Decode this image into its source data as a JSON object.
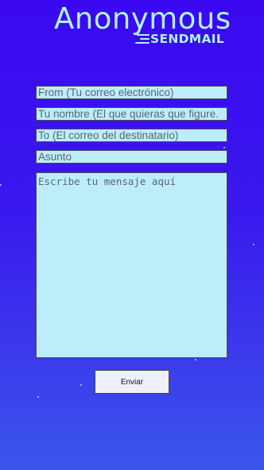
{
  "logo": {
    "title": "Anonymous",
    "subtitle": "SENDMAIL"
  },
  "form": {
    "from_placeholder": "From (Tu correo electrónico)",
    "name_placeholder": "Tu nombre (El que quieras que figure.",
    "to_placeholder": "To (El correo del destinatario)",
    "subject_placeholder": "Asunto",
    "message_placeholder": "Escribe tu mensaje aquí",
    "submit_label": "Enviar"
  },
  "colors": {
    "background_top": "#3a08f0",
    "background_bottom": "#3b57ea",
    "field_background": "#bdedfb",
    "logo_color": "#aef4f8",
    "button_background": "#eef0ff"
  }
}
